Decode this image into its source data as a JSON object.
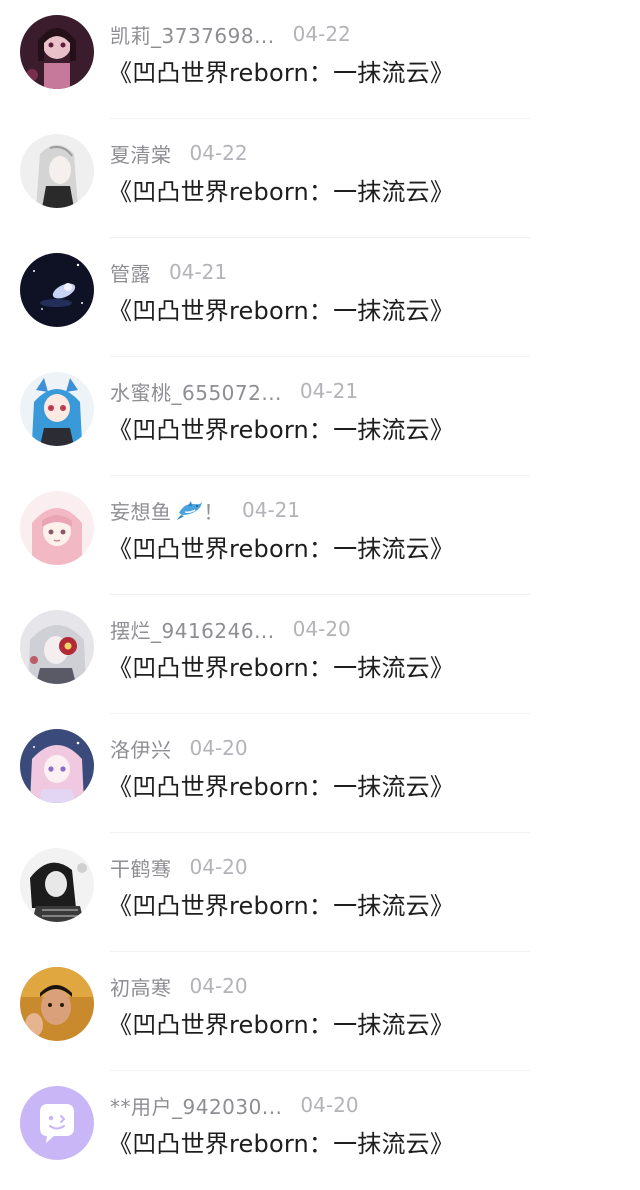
{
  "comments": [
    {
      "name": "凯莉_3737698...",
      "date": "04-22",
      "text": "《凹凸世界reborn：一抹流云》",
      "avatar_icon": "avatar-dark-girl"
    },
    {
      "name": "夏清棠",
      "date": "04-22",
      "text": "《凹凸世界reborn：一抹流云》",
      "avatar_icon": "avatar-white-hair"
    },
    {
      "name": "管露",
      "date": "04-21",
      "text": "《凹凸世界reborn：一抹流云》",
      "avatar_icon": "avatar-space"
    },
    {
      "name": "水蜜桃_655072...",
      "date": "04-21",
      "text": "《凹凸世界reborn：一抹流云》",
      "avatar_icon": "avatar-blue-hair"
    },
    {
      "name": "妄想鱼",
      "name_suffix": "！",
      "has_dolphin": true,
      "date": "04-21",
      "text": "《凹凸世界reborn：一抹流云》",
      "avatar_icon": "avatar-pink-hair"
    },
    {
      "name": "摆烂_9416246...",
      "date": "04-20",
      "text": "《凹凸世界reborn：一抹流云》",
      "avatar_icon": "avatar-flower-girl"
    },
    {
      "name": "洛伊兴",
      "date": "04-20",
      "text": "《凹凸世界reborn：一抹流云》",
      "avatar_icon": "avatar-anime-pink"
    },
    {
      "name": "干鹤骞",
      "date": "04-20",
      "text": "《凹凸世界reborn：一抹流云》",
      "avatar_icon": "avatar-mono-girl"
    },
    {
      "name": "初高寒",
      "date": "04-20",
      "text": "《凹凸世界reborn：一抹流云》",
      "avatar_icon": "avatar-photo-boy"
    },
    {
      "name": "**用户_942030...",
      "date": "04-20",
      "text": "《凹凸世界reborn：一抹流云》",
      "avatar_icon": "avatar-default-chat"
    }
  ],
  "colors": {
    "name": "#8e8e93",
    "date": "#b3b3b8",
    "title": "#1e1e1e",
    "divider": "#f1f1f3",
    "default_avatar": "#c9b6f7"
  }
}
